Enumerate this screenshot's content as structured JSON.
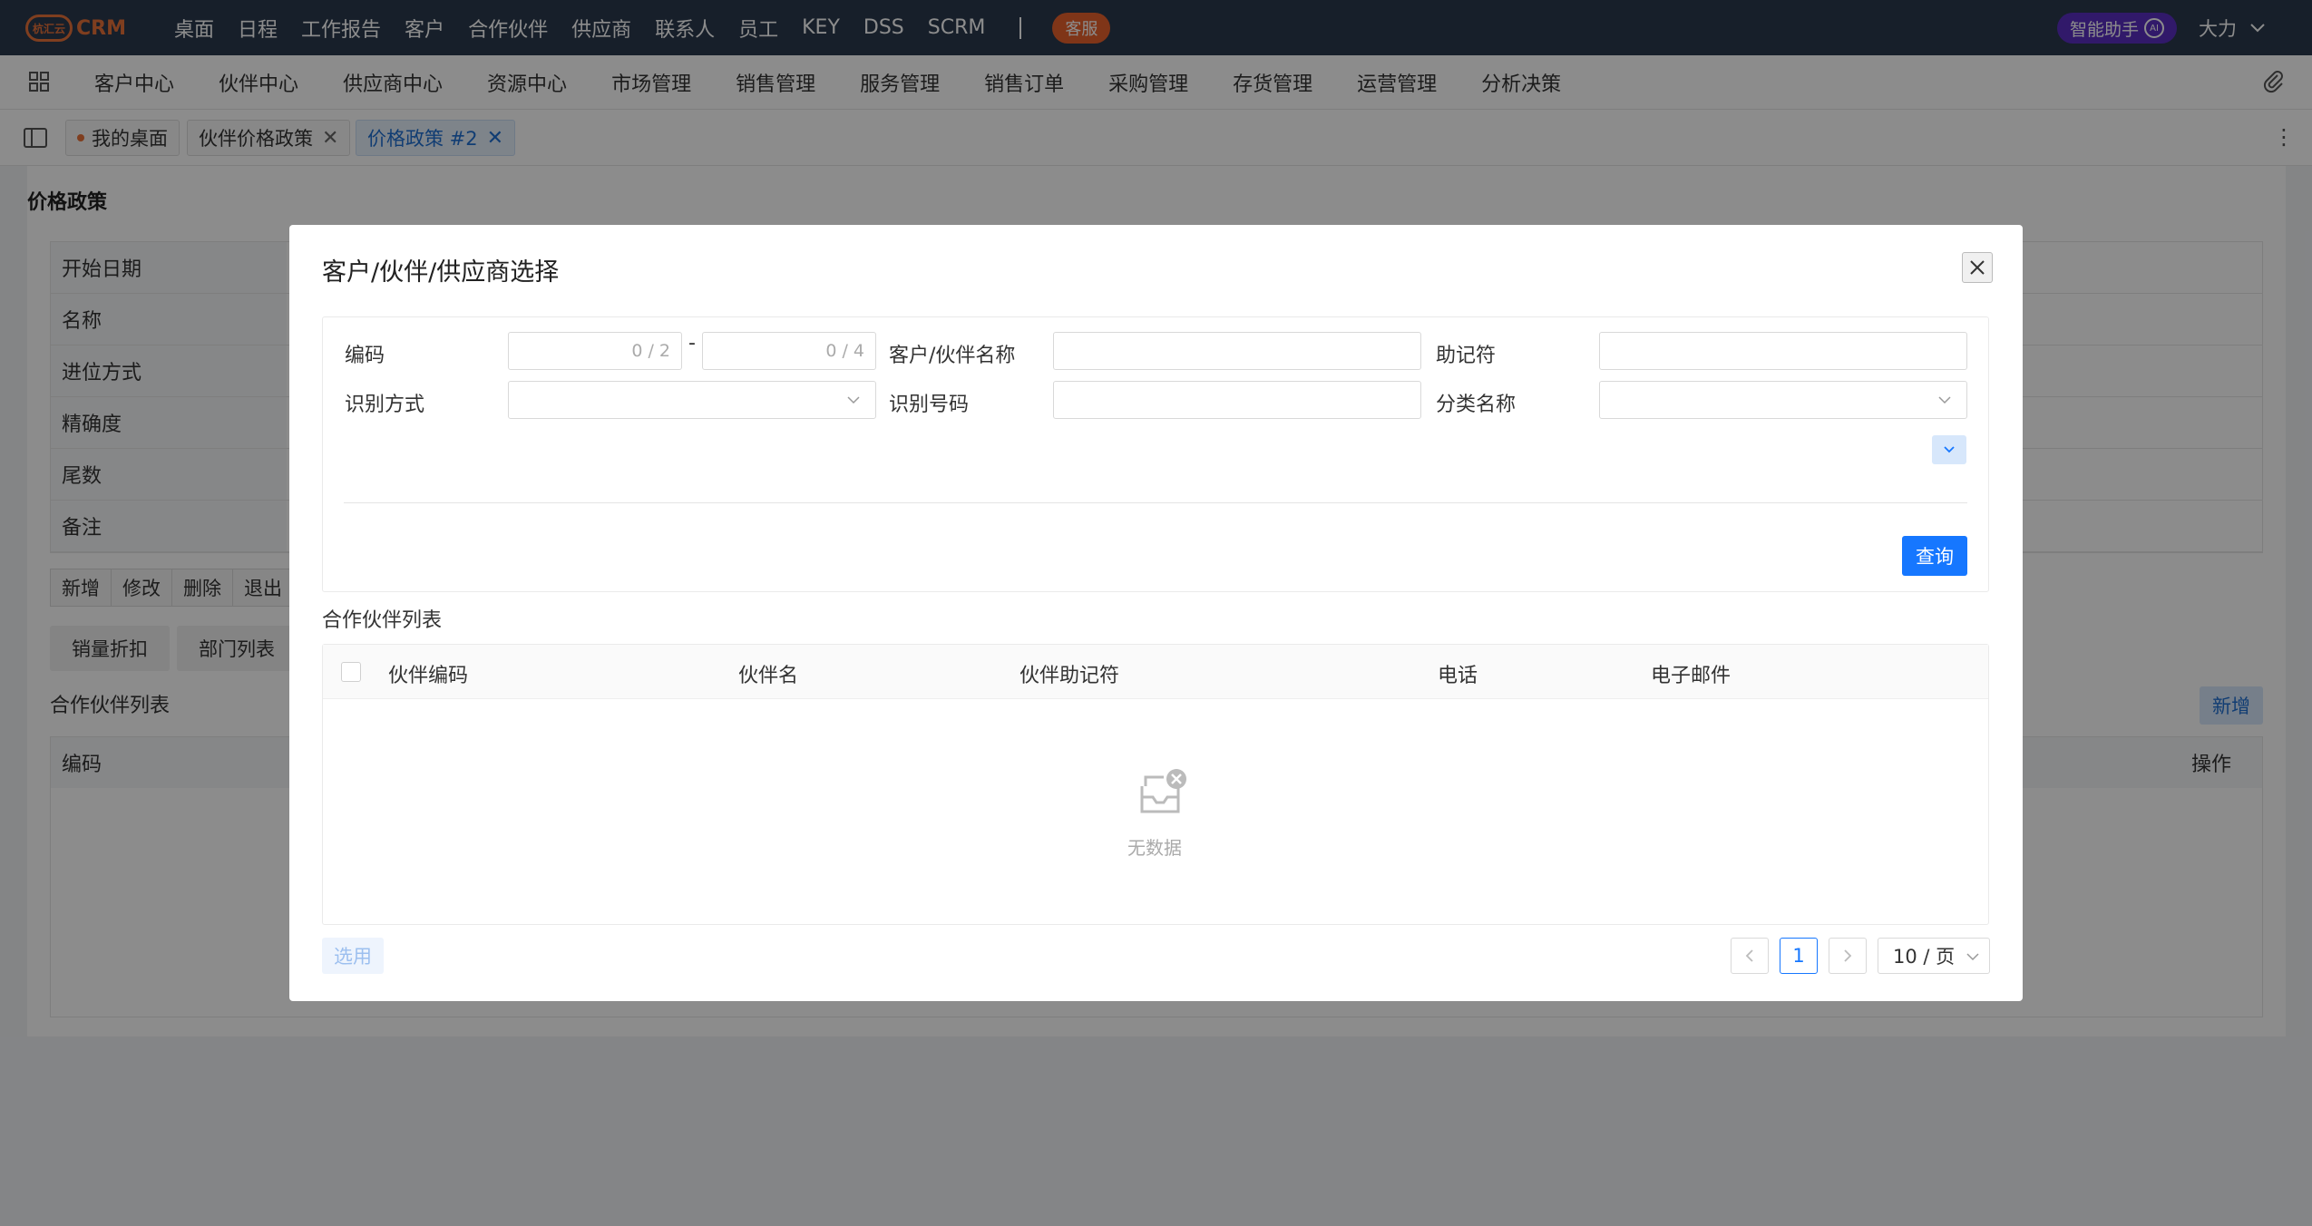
{
  "brand": {
    "logo_mark": "杭汇云",
    "logo_text": "CRM"
  },
  "topnav": [
    "桌面",
    "日程",
    "工作报告",
    "客户",
    "合作伙伴",
    "供应商",
    "联系人",
    "员工",
    "KEY",
    "DSS",
    "SCRM"
  ],
  "service_badge": "客服",
  "ai_assistant": {
    "label": "智能助手",
    "icon_text": "AI"
  },
  "user": {
    "name": "大力"
  },
  "modules": [
    "客户中心",
    "伙伴中心",
    "供应商中心",
    "资源中心",
    "市场管理",
    "销售管理",
    "服务管理",
    "销售订单",
    "采购管理",
    "存货管理",
    "运营管理",
    "分析决策"
  ],
  "tabs": [
    {
      "label": "我的桌面"
    },
    {
      "label": "伙伴价格政策"
    },
    {
      "label": "价格政策 #2"
    }
  ],
  "background_page": {
    "title": "价格政策",
    "form_labels": [
      "开始日期",
      "名称",
      "进位方式",
      "精确度",
      "尾数",
      "备注"
    ],
    "buttons": [
      "新增",
      "修改",
      "删除",
      "退出"
    ],
    "subtabs": [
      "销量折扣",
      "部门列表"
    ],
    "list_title": "合作伙伴列表",
    "add_label": "新增",
    "columns": {
      "code": "编码",
      "action": "操作"
    }
  },
  "modal": {
    "title": "客户/伙伴/供应商选择",
    "fields": {
      "code_label": "编码",
      "code_from_count": "0 / 2",
      "code_to_count": "0 / 4",
      "range_sep": "-",
      "name_label": "客户/伙伴名称",
      "mnemonic_label": "助记符",
      "id_type_label": "识别方式",
      "id_number_label": "识别号码",
      "category_label": "分类名称"
    },
    "query_label": "查询",
    "list_title": "合作伙伴列表",
    "columns": [
      "伙伴编码",
      "伙伴名",
      "伙伴助记符",
      "电话",
      "电子邮件"
    ],
    "empty_text": "无数据",
    "select_label": "选用",
    "pagination": {
      "current_page": "1",
      "page_size": "10 / 页"
    }
  },
  "colors": {
    "topbar": "#2b3a4e",
    "brand": "#e8713a",
    "primary": "#1677ff",
    "ai": "#5a2fc2"
  }
}
